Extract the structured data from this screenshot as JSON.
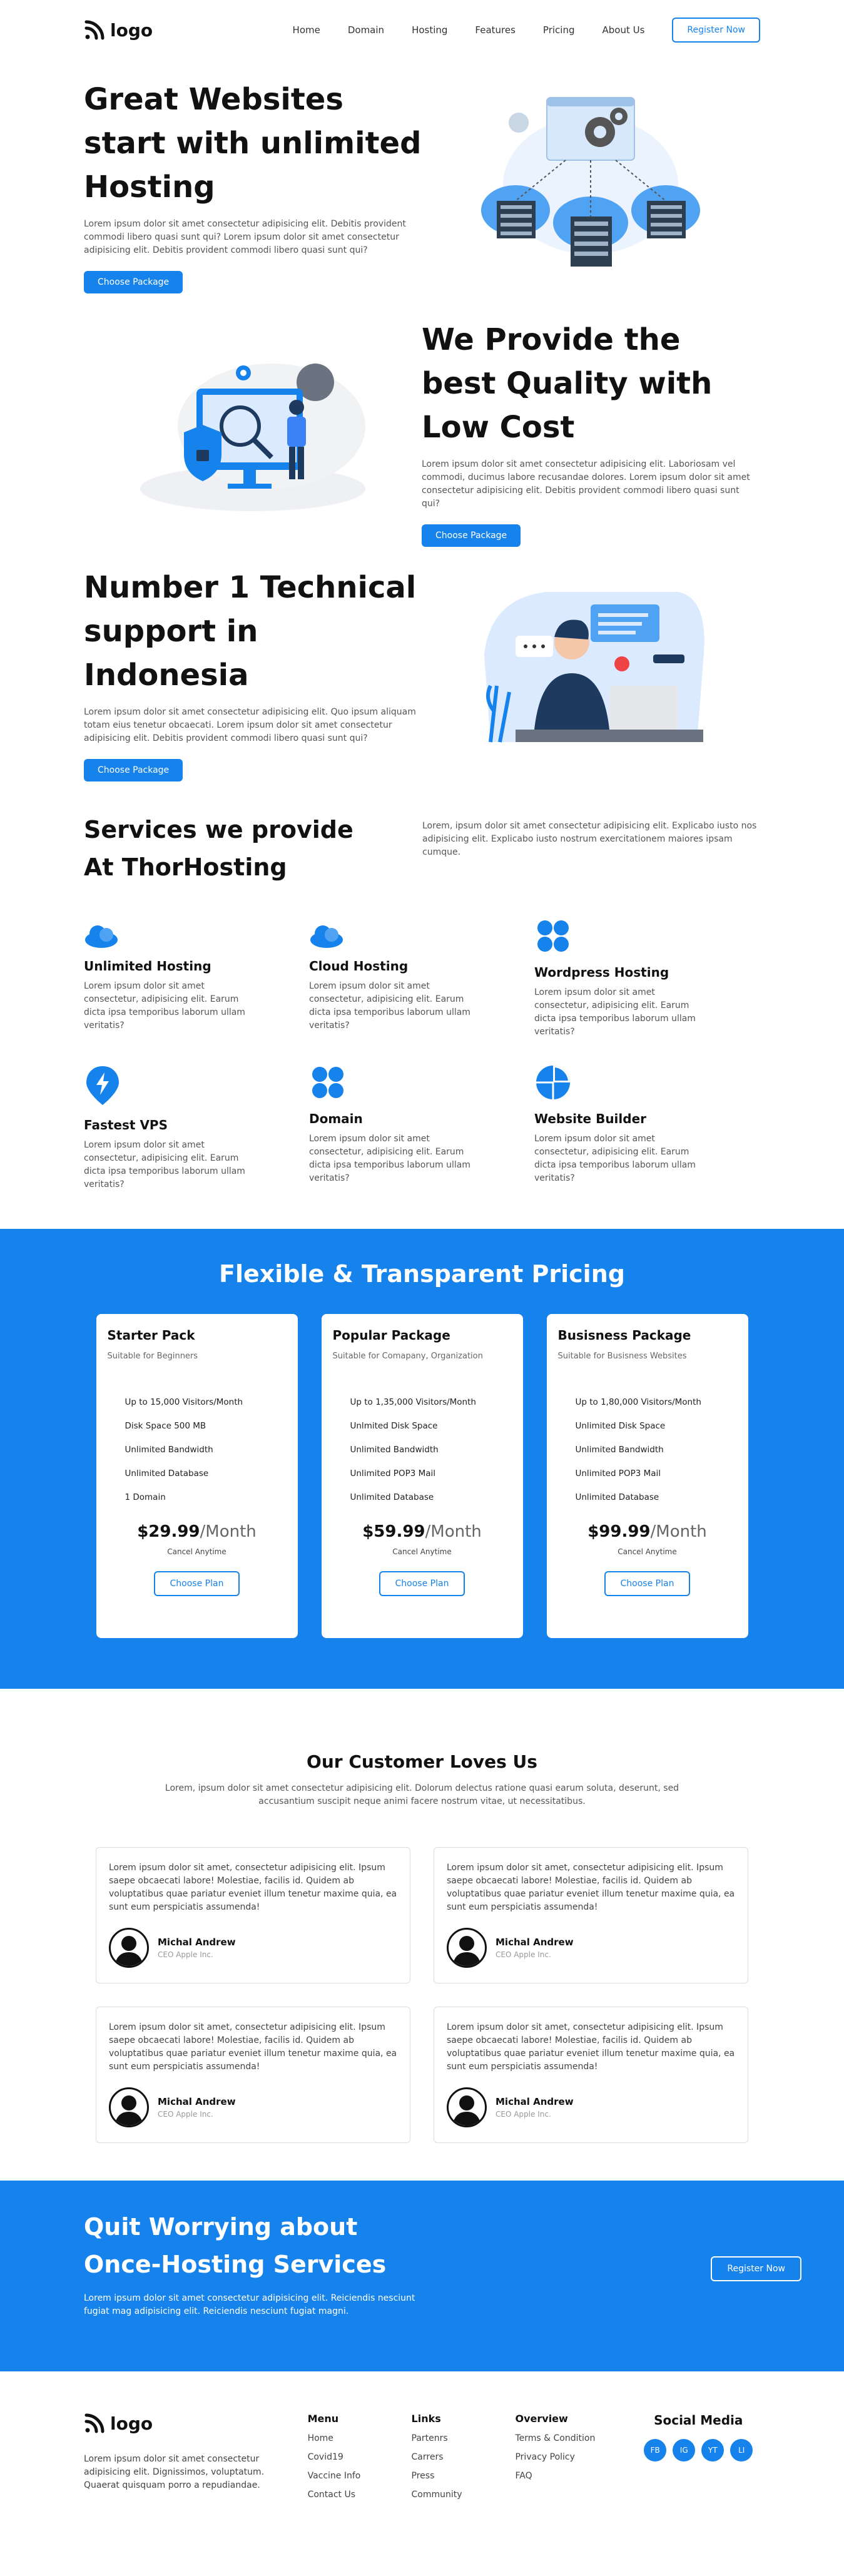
{
  "brand": {
    "logo_text": "logo"
  },
  "nav": {
    "items": [
      "Home",
      "Domain",
      "Hosting",
      "Features",
      "Pricing",
      "About Us"
    ],
    "register_label": "Register Now"
  },
  "hero1": {
    "title": "Great Websites start with unlimited Hosting",
    "text": "Lorem ipsum dolor sit amet consectetur adipisicing elit. Debitis provident commodi libero quasi sunt qui? Lorem ipsum dolor sit amet consectetur adipisicing elit. Debitis provident commodi libero quasi sunt qui?",
    "button": "Choose Package"
  },
  "hero2": {
    "title": "We Provide the best Quality with Low Cost",
    "text": "Lorem ipsum dolor sit amet consectetur adipisicing elit. Laboriosam vel commodi, ducimus labore recusandae dolores. Lorem ipsum dolor sit amet consectetur adipisicing elit. Debitis provident commodi libero quasi sunt qui?",
    "button": "Choose Package"
  },
  "hero3": {
    "title": "Number 1 Technical support in Indonesia",
    "text": "Lorem ipsum dolor sit amet consectetur adipisicing elit. Quo ipsum aliquam totam eius tenetur obcaecati. Lorem ipsum dolor sit amet consectetur adipisicing elit. Debitis provident commodi libero quasi sunt qui?",
    "button": "Choose Package"
  },
  "services": {
    "title_line1": "Services we provide",
    "title_line2": "At ThorHosting",
    "desc": "Lorem, ipsum dolor sit amet consectetur adipisicing elit. Explicabo iusto nos adipisicing elit. Explicabo iusto nostrum exercitationem maiores ipsam cumque.",
    "items": [
      {
        "name": "Unlimited Hosting",
        "icon": "cloud-icon",
        "text": "Lorem ipsum dolor sit amet consectetur, adipisicing elit. Earum dicta ipsa temporibus laborum ullam veritatis?"
      },
      {
        "name": "Cloud Hosting",
        "icon": "cloud-icon",
        "text": "Lorem ipsum dolor sit amet consectetur, adipisicing elit. Earum dicta ipsa temporibus laborum ullam veritatis?"
      },
      {
        "name": "Wordpress Hosting",
        "icon": "grid-icon",
        "text": "Lorem ipsum dolor sit amet consectetur, adipisicing elit. Earum dicta ipsa temporibus laborum ullam veritatis?"
      },
      {
        "name": "Fastest VPS",
        "icon": "lightning-icon",
        "text": "Lorem ipsum dolor sit amet consectetur, adipisicing elit. Earum dicta ipsa temporibus laborum ullam veritatis?"
      },
      {
        "name": "Domain",
        "icon": "grid-icon",
        "text": "Lorem ipsum dolor sit amet consectetur, adipisicing elit. Earum dicta ipsa temporibus laborum ullam veritatis?"
      },
      {
        "name": "Website Builder",
        "icon": "pie-icon",
        "text": "Lorem ipsum dolor sit amet consectetur, adipisicing elit. Earum dicta ipsa temporibus laborum ullam veritatis?"
      }
    ]
  },
  "pricing": {
    "title": "Flexible & Transparent Pricing",
    "plans": [
      {
        "name": "Starter Pack",
        "sub": "Suitable for Beginners",
        "features": [
          "Up to 15,000 Visitors/Month",
          "Disk Space 500 MB",
          "Unlimited Bandwidth",
          "Unlimited Database",
          "1 Domain"
        ],
        "price": "$29.99",
        "per": "/Month",
        "cancel": "Cancel Anytime",
        "button": "Choose Plan"
      },
      {
        "name": "Popular Package",
        "sub": "Suitable for Comapany, Organization",
        "features": [
          "Up to 1,35,000 Visitors/Month",
          "Unlmited Disk Space",
          "Unlimited Bandwidth",
          "Unlimited POP3 Mail",
          "Unlimited Database"
        ],
        "price": "$59.99",
        "per": "/Month",
        "cancel": "Cancel Anytime",
        "button": "Choose Plan"
      },
      {
        "name": "Busisness Package",
        "sub": "Suitable for Busisness Websites",
        "features": [
          "Up to 1,80,000 Visitors/Month",
          "Unlimited Disk Space",
          "Unlimited Bandwidth",
          "Unlimited POP3 Mail",
          "Unlimited Database"
        ],
        "price": "$99.99",
        "per": "/Month",
        "cancel": "Cancel Anytime",
        "button": "Choose Plan"
      }
    ]
  },
  "testimonials": {
    "title": "Our Customer Loves Us",
    "intro": "Lorem, ipsum dolor sit amet consectetur adipisicing elit. Dolorum delectus ratione quasi earum soluta, deserunt, sed accusantium suscipit neque animi facere nostrum vitae, ut necessitatibus.",
    "items": [
      {
        "quote": "Lorem ipsum dolor sit amet, consectetur adipisicing elit. Ipsum saepe obcaecati labore! Molestiae, facilis id. Quidem ab voluptatibus quae pariatur eveniet illum tenetur maxime quia, ea sunt eum perspiciatis assumenda!",
        "name": "Michal Andrew",
        "role": "CEO Apple Inc."
      },
      {
        "quote": "Lorem ipsum dolor sit amet, consectetur adipisicing elit. Ipsum saepe obcaecati labore! Molestiae, facilis id. Quidem ab voluptatibus quae pariatur eveniet illum tenetur maxime quia, ea sunt eum perspiciatis assumenda!",
        "name": "Michal Andrew",
        "role": "CEO Apple Inc."
      },
      {
        "quote": "Lorem ipsum dolor sit amet, consectetur adipisicing elit. Ipsum saepe obcaecati labore! Molestiae, facilis id. Quidem ab voluptatibus quae pariatur eveniet illum tenetur maxime quia, ea sunt eum perspiciatis assumenda!",
        "name": "Michal Andrew",
        "role": "CEO Apple Inc."
      },
      {
        "quote": "Lorem ipsum dolor sit amet, consectetur adipisicing elit. Ipsum saepe obcaecati labore! Molestiae, facilis id. Quidem ab voluptatibus quae pariatur eveniet illum tenetur maxime quia, ea sunt eum perspiciatis assumenda!",
        "name": "Michal Andrew",
        "role": "CEO Apple Inc."
      }
    ]
  },
  "cta": {
    "title_line1": "Quit Worrying about",
    "title_line2": "Once-Hosting Services",
    "text": "Lorem ipsum dolor sit amet consectetur adipisicing elit. Reiciendis nesciunt fugiat mag adipisicing elit. Reiciendis nesciunt fugiat magni.",
    "button": "Register Now"
  },
  "footer": {
    "logo_text": "logo",
    "text": "Lorem ipsum dolor sit amet consectetur adipisicing elit. Dignissimos, voluptatum. Quaerat quisquam porro a repudiandae.",
    "menu_title": "Menu",
    "menu": [
      "Home",
      "Covid19",
      "Vaccine Info",
      "Contact Us"
    ],
    "links_title": "Links",
    "links": [
      "Partenrs",
      "Carrers",
      "Press",
      "Community"
    ],
    "overview_title": "Overview",
    "overview": [
      "Terms & Condition",
      "Privacy Policy",
      "FAQ"
    ],
    "social_title": "Social Media",
    "social": [
      "FB",
      "IG",
      "YT",
      "LI"
    ]
  },
  "colors": {
    "accent": "#1683ec"
  }
}
